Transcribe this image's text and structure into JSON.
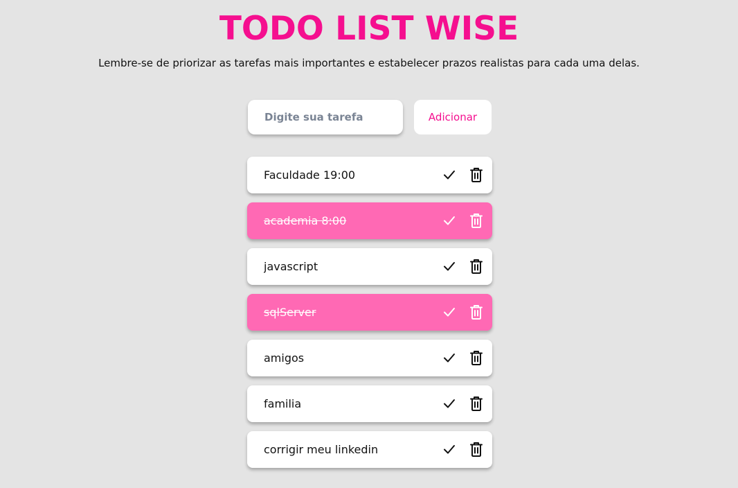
{
  "header": {
    "title": "TODO LIST WISE",
    "subtitle": "Lembre-se de priorizar as tarefas mais importantes e estabelecer prazos realistas para cada uma delas."
  },
  "form": {
    "placeholder": "Digite sua tarefa",
    "add_label": "Adicionar"
  },
  "tasks": [
    {
      "text": "Faculdade 19:00",
      "done": false
    },
    {
      "text": "academia 8:00",
      "done": true
    },
    {
      "text": "javascript",
      "done": false
    },
    {
      "text": "sqlServer",
      "done": true
    },
    {
      "text": "amigos",
      "done": false
    },
    {
      "text": "familia",
      "done": false
    },
    {
      "text": "corrigir meu linkedin",
      "done": false
    }
  ],
  "icons": {
    "complete": "check-icon",
    "delete": "trash-icon"
  },
  "colors": {
    "accent": "#f50f8f",
    "done_background": "#ff69b4",
    "page_background": "#e4e4e4",
    "card_background": "#ffffff"
  }
}
